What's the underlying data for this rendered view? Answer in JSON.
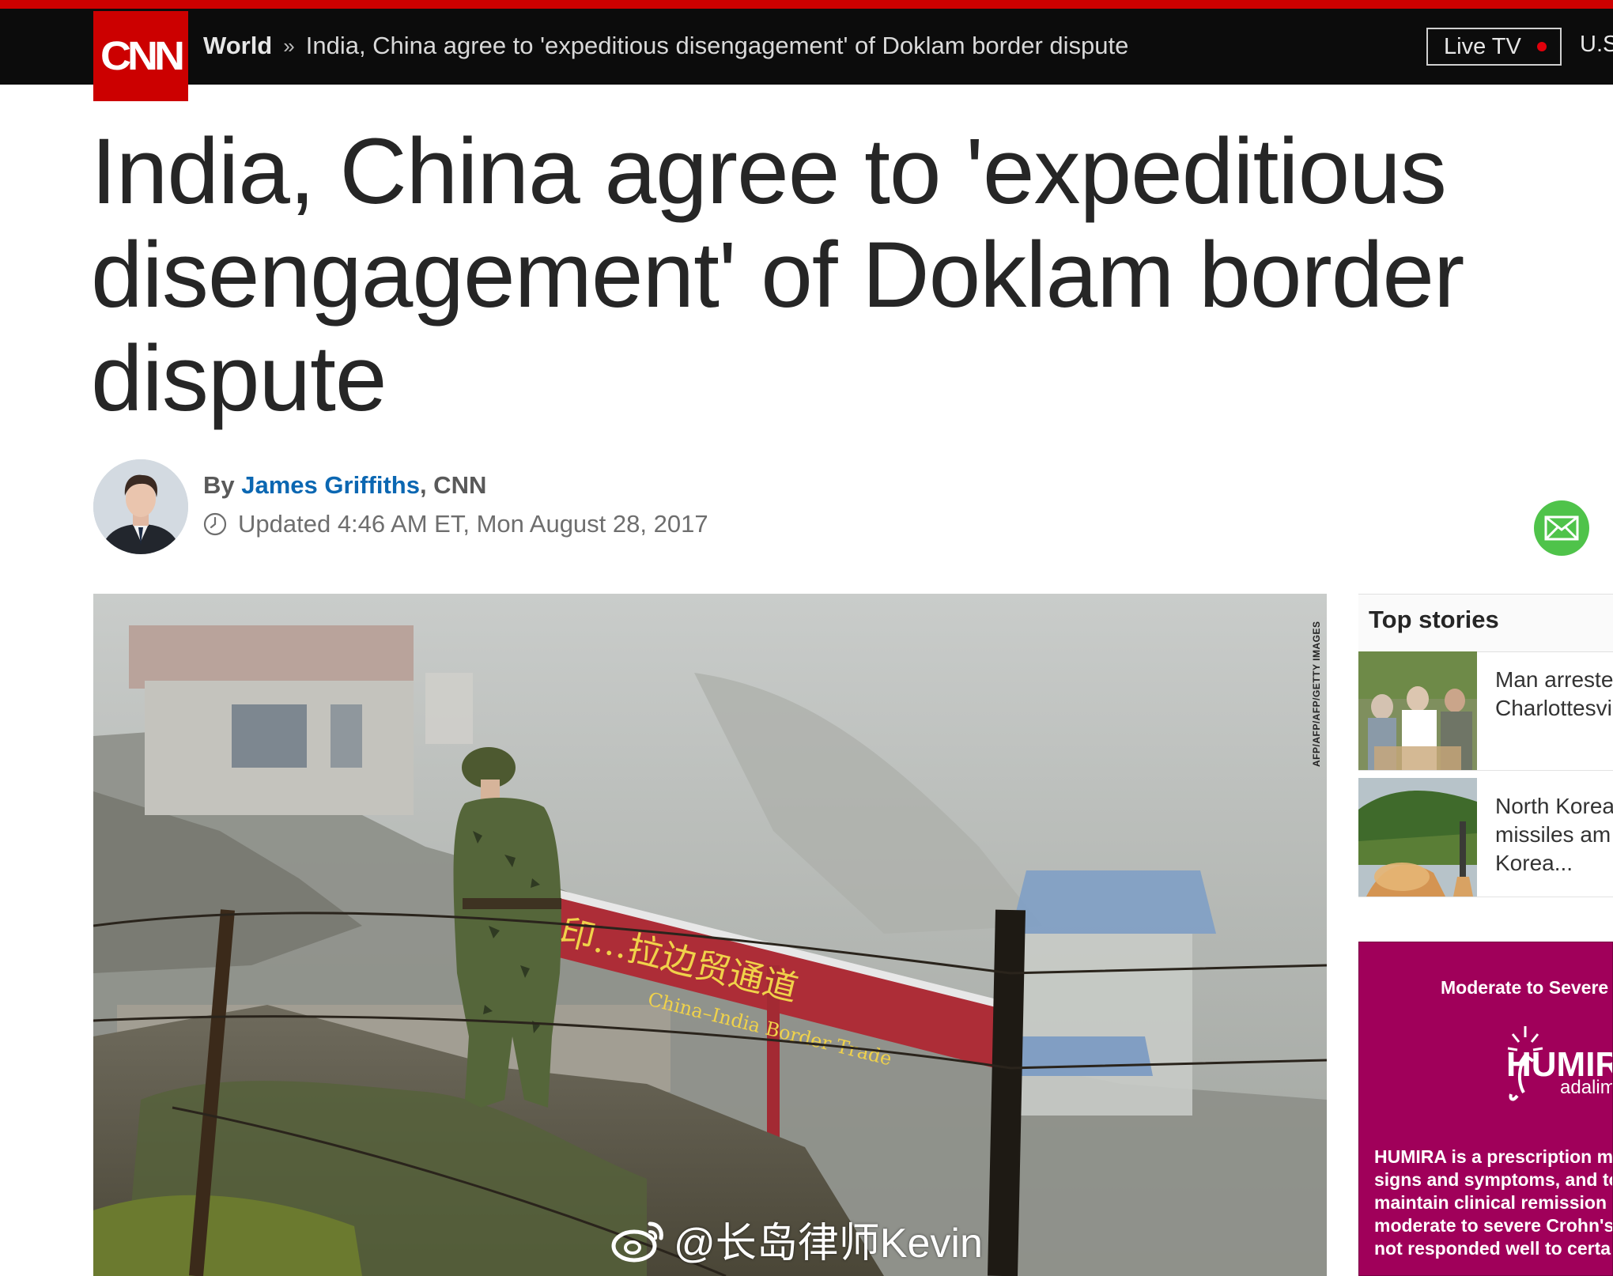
{
  "header": {
    "logo_text": "CNN",
    "section": "World",
    "separator": "»",
    "breadcrumb_title": "India, China agree to 'expeditious disengagement' of Doklam border dispute",
    "live_tv_label": "Live TV",
    "edition_label": "U.S."
  },
  "article": {
    "headline": "India, China agree to 'expeditious disengagement' of Doklam border dispute",
    "by_prefix": "By ",
    "author": "James Griffiths",
    "outlet": ", CNN",
    "updated": "Updated 4:46 AM ET, Mon August 28, 2017",
    "photo_credit": "AFP/AFP/AFP/GETTY IMAGES",
    "sign_chinese": "中印…拉边贸通道",
    "sign_english": "China–India Border Trade"
  },
  "watermark": {
    "text": "@长岛律师Kevin"
  },
  "sidebar": {
    "top_stories_title": "Top stories",
    "stories": [
      {
        "text": "Man arrested\nCharlottesville"
      },
      {
        "text": "North Korea\nmissiles am\nKorea..."
      }
    ]
  },
  "ad": {
    "top_label": "Moderate to Severe",
    "brand": "HUMIRA",
    "brand_sub": "adalimumab",
    "body": "HUMIRA is a prescription m\nsigns and symptoms, and to\nmaintain clinical remission i\nmoderate to severe Crohn's\nnot responded well to certa"
  },
  "colors": {
    "brand_red": "#cc0000",
    "nav_black": "#0c0c0c",
    "author_link": "#0b67b2",
    "email_green": "#4fc34a",
    "ad_magenta": "#a0005a"
  }
}
